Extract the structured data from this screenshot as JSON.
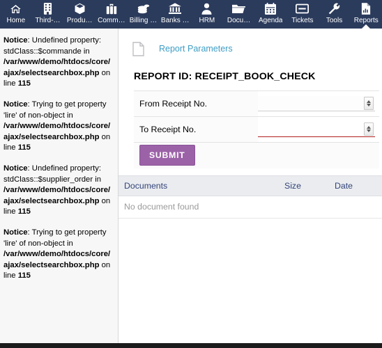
{
  "nav": {
    "items": [
      {
        "label": "Home",
        "icon": "home-icon",
        "active": false
      },
      {
        "label": "Third-…",
        "icon": "building-icon",
        "active": false
      },
      {
        "label": "Produ…",
        "icon": "box-icon",
        "active": false
      },
      {
        "label": "Comm…",
        "icon": "briefcase-icon",
        "active": false
      },
      {
        "label": "Billing …",
        "icon": "coins-icon",
        "active": false
      },
      {
        "label": "Banks …",
        "icon": "bank-icon",
        "active": false
      },
      {
        "label": "HRM",
        "icon": "user-icon",
        "active": false
      },
      {
        "label": "Docu…",
        "icon": "folder-icon",
        "active": false
      },
      {
        "label": "Agenda",
        "icon": "calendar-icon",
        "active": false
      },
      {
        "label": "Tickets",
        "icon": "ticket-icon",
        "active": false
      },
      {
        "label": "Tools",
        "icon": "wrench-icon",
        "active": false
      },
      {
        "label": "Reports",
        "icon": "report-icon",
        "active": true
      }
    ],
    "background": "#2b3b5c"
  },
  "errors": {
    "notices": [
      {
        "prefix": "Notice",
        "message": ": Undefined property: stdClass::$commande in ",
        "path": "/var/www/demo/htdocs/core/ajax/selectsearchbox.php",
        "suffix": " on line ",
        "line": "115"
      },
      {
        "prefix": "Notice",
        "message": ": Trying to get property 'lire' of non-object in ",
        "path": "/var/www/demo/htdocs/core/ajax/selectsearchbox.php",
        "suffix": " on line ",
        "line": "115"
      },
      {
        "prefix": "Notice",
        "message": ": Undefined property: stdClass::$supplier_order in ",
        "path": "/var/www/demo/htdocs/core/ajax/selectsearchbox.php",
        "suffix": " on line ",
        "line": "115"
      },
      {
        "prefix": "Notice",
        "message": ": Trying to get property 'lire' of non-object in ",
        "path": "/var/www/demo/htdocs/core/ajax/selectsearchbox.php",
        "suffix": " on line ",
        "line": "115"
      }
    ]
  },
  "main": {
    "breadcrumb_label": "Report Parameters",
    "breadcrumb_icon": "document-icon",
    "breadcrumb_color": "#3d9dc4",
    "report_title": "REPORT ID: RECEIPT_BOOK_CHECK",
    "form": {
      "rows": [
        {
          "label": "From Receipt No.",
          "value": "",
          "placeholder": "",
          "error": false
        },
        {
          "label": "To Receipt No.",
          "value": "",
          "placeholder": "",
          "error": true
        }
      ],
      "submit_label": "SUBMIT",
      "submit_color": "#9c62a8",
      "error_color": "#b02020"
    },
    "documents": {
      "col_documents": "Documents",
      "col_size": "Size",
      "col_date": "Date",
      "empty_text": "No document found",
      "header_color": "#33447a"
    }
  }
}
